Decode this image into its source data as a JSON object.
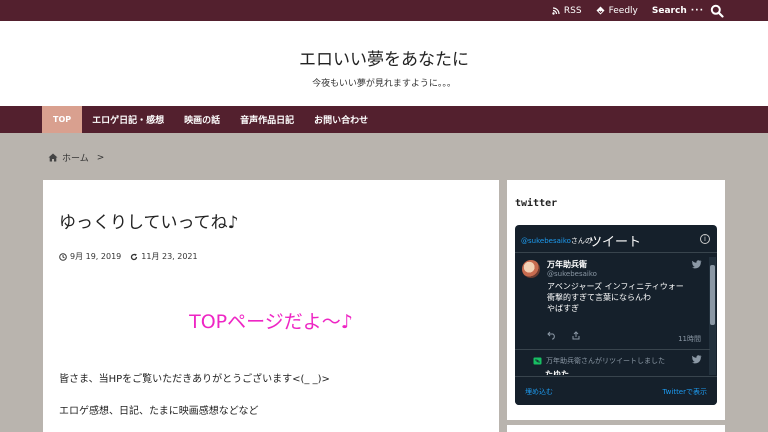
{
  "topbar": {
    "rss_label": "RSS",
    "feedly_label": "Feedly",
    "search_label": "Search",
    "search_dots": "···"
  },
  "header": {
    "site_title": "エロいい夢をあなたに",
    "tagline": "今夜もいい夢が見れますように。。。"
  },
  "nav": {
    "items": [
      {
        "label": "TOP",
        "active": true
      },
      {
        "label": "エロゲ日記・感想",
        "active": false
      },
      {
        "label": "映画の話",
        "active": false
      },
      {
        "label": "音声作品日記",
        "active": false
      },
      {
        "label": "お問い合わせ",
        "active": false
      }
    ]
  },
  "breadcrumb": {
    "home_label": "ホーム",
    "separator": ">"
  },
  "post": {
    "title": "ゆっくりしていってね♪",
    "published": "9月 19, 2019",
    "updated": "11月 23, 2021",
    "pink_heading": "TOPページだよ～♪",
    "paragraph_1": "皆さま、当HPをご覧いただきありがとうございます<(_ _)>",
    "paragraph_2": "エロゲ感想、日記、たまに映画感想などなど"
  },
  "sidebar": {
    "title": "twitter"
  },
  "twitter": {
    "handle_small": "@sukebesaiko",
    "head_suffix": "さんの",
    "head_title": "ツイート",
    "info_symbol": "i",
    "tweet_name": "万年助兵衛",
    "tweet_handle": "@sukebesaiko",
    "tweet_line_1": "アベンジャーズ インフィニティウォー",
    "tweet_line_2": "衝撃的すぎて言葉にならんわ",
    "tweet_line_3": "やばすぎ",
    "tweet_time": "11時間",
    "retweet_note": "万年助兵衛さんがリツイートしました",
    "partial_name": "たゆた",
    "embed_label": "埋め込む",
    "view_label": "Twitterで表示"
  },
  "colors": {
    "topbar": "#53202e",
    "nav_active": "#d9a08f",
    "page_bg": "#b9b4ae",
    "pink_heading": "#ee26c4",
    "twitter_bg": "#15202b",
    "twitter_link": "#1d9bf0"
  },
  "icons": {
    "rss": "rss-icon",
    "feedly": "feedly-icon",
    "search": "search-icon",
    "home": "home-icon",
    "clock": "clock-icon",
    "update": "refresh-icon",
    "bird": "twitter-bird-icon",
    "reply": "reply-icon",
    "share": "share-icon",
    "info": "info-icon"
  }
}
